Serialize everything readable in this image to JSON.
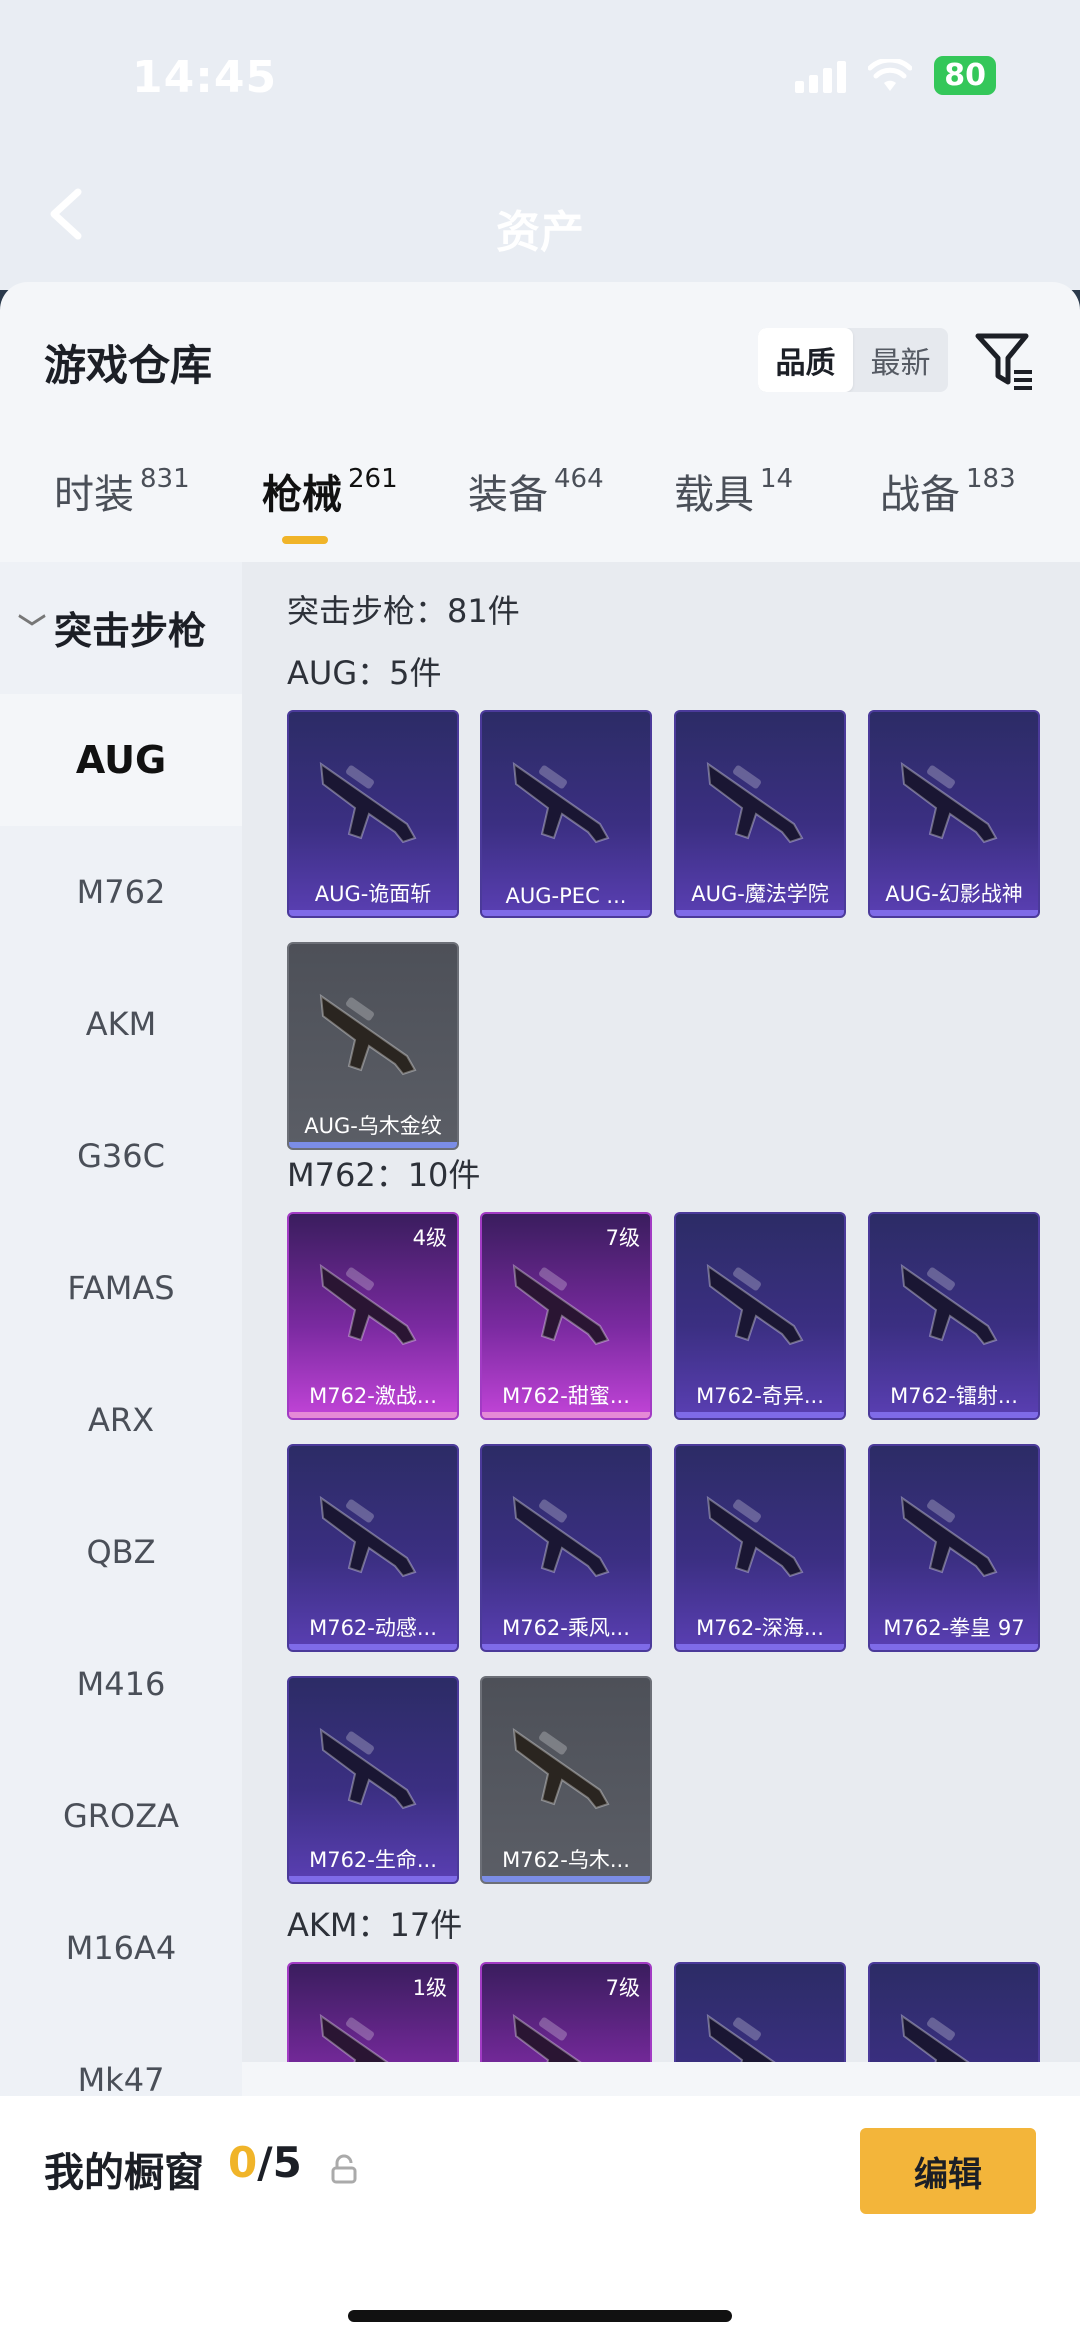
{
  "status": {
    "time": "14:45",
    "battery": "80"
  },
  "header": {
    "title": "资产"
  },
  "sheet": {
    "title": "游戏仓库",
    "sort": {
      "options": [
        "品质",
        "最新"
      ],
      "active": "品质"
    }
  },
  "tabs": [
    {
      "label": "时装",
      "count": "831"
    },
    {
      "label": "枪械",
      "count": "261",
      "active": true
    },
    {
      "label": "装备",
      "count": "464"
    },
    {
      "label": "载具",
      "count": "14"
    },
    {
      "label": "战备",
      "count": "183"
    }
  ],
  "sidebar": {
    "header": "突击步枪",
    "items": [
      "AUG",
      "M762",
      "AKM",
      "G36C",
      "FAMAS",
      "ARX",
      "QBZ",
      "M416",
      "GROZA",
      "M16A4",
      "Mk47"
    ],
    "active": "AUG"
  },
  "content": {
    "summary": "突击步枪：81件",
    "sections": [
      {
        "label": "AUG：5件",
        "items": [
          {
            "name": "AUG-诡面斩",
            "style": "purple"
          },
          {
            "name": "AUG-PEC ...",
            "style": "purple"
          },
          {
            "name": "AUG-魔法学院",
            "style": "purple"
          },
          {
            "name": "AUG-幻影战神",
            "style": "purple"
          },
          {
            "name": "AUG-乌木金纹",
            "style": "gray"
          }
        ]
      },
      {
        "label": "M762：10件",
        "items": [
          {
            "name": "M762-激战...",
            "style": "pink",
            "level": "4级"
          },
          {
            "name": "M762-甜蜜...",
            "style": "pink",
            "level": "7级"
          },
          {
            "name": "M762-奇异...",
            "style": "purple"
          },
          {
            "name": "M762-镭射...",
            "style": "purple"
          },
          {
            "name": "M762-动感...",
            "style": "purple"
          },
          {
            "name": "M762-乘风...",
            "style": "purple"
          },
          {
            "name": "M762-深海...",
            "style": "purple"
          },
          {
            "name": "M762-拳皇 97",
            "style": "purple"
          },
          {
            "name": "M762-生命...",
            "style": "purple"
          },
          {
            "name": "M762-乌木...",
            "style": "gray"
          }
        ]
      },
      {
        "label": "AKM：17件",
        "items": [
          {
            "name": "",
            "style": "pink",
            "level": "1级"
          },
          {
            "name": "",
            "style": "pink",
            "level": "7级"
          },
          {
            "name": "",
            "style": "purple"
          },
          {
            "name": "",
            "style": "purple"
          }
        ]
      }
    ]
  },
  "showcase": {
    "title": "我的橱窗",
    "current": "0",
    "total": "/5",
    "edit_label": "编辑"
  },
  "colors": {
    "accent": "#f0b429",
    "card_purple": "#3b2f82",
    "card_pink": "#c244d8",
    "card_gray": "#5b5e66"
  }
}
